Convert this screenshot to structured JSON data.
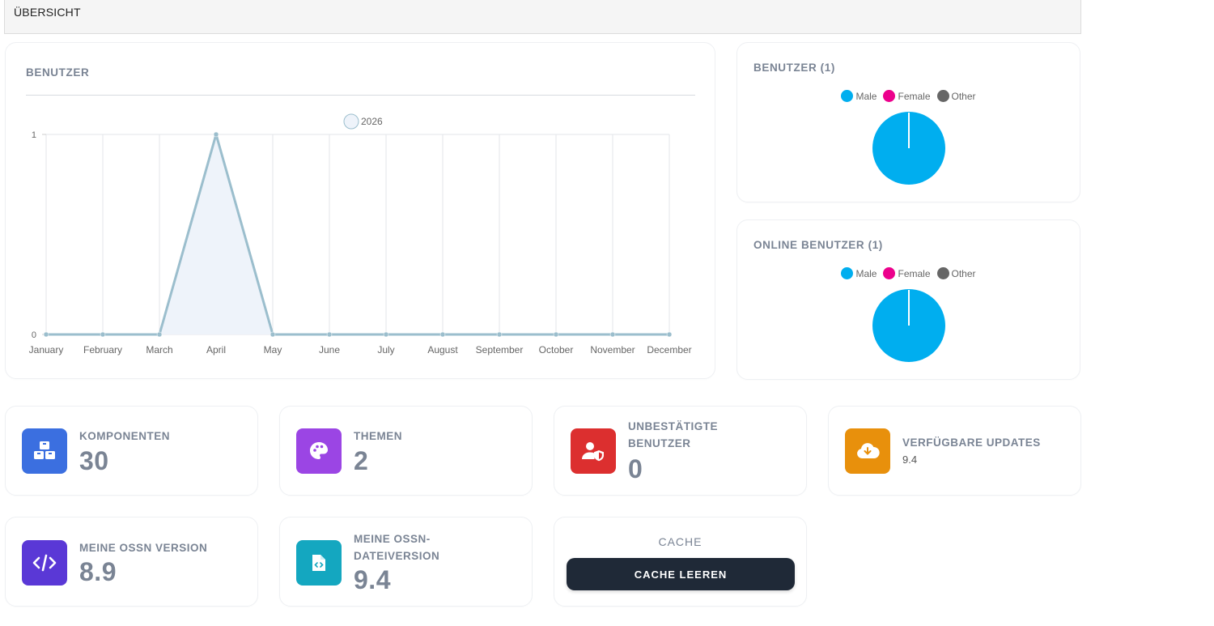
{
  "header": {
    "title": "ÜBERSICHT"
  },
  "users_chart": {
    "title": "BENUTZER",
    "chart_data": {
      "type": "line",
      "categories": [
        "January",
        "February",
        "March",
        "April",
        "May",
        "June",
        "July",
        "August",
        "September",
        "October",
        "November",
        "December"
      ],
      "series": [
        {
          "name": "2026",
          "values": [
            0,
            0,
            0,
            1,
            0,
            0,
            0,
            0,
            0,
            0,
            0,
            0
          ]
        }
      ],
      "ylim": [
        0,
        1
      ],
      "yticks": [
        "0",
        "1"
      ],
      "grid": true,
      "legend_placement": "top-center",
      "line_color": "#9bbecd",
      "fill_color": "#eef3fa"
    }
  },
  "pie_users": {
    "title": "BENUTZER (1)",
    "legend": [
      {
        "label": "Male",
        "color": "#00aeef"
      },
      {
        "label": "Female",
        "color": "#ec008c"
      },
      {
        "label": "Other",
        "color": "#666666"
      }
    ],
    "chart_data": {
      "type": "pie",
      "categories": [
        "Male",
        "Female",
        "Other"
      ],
      "values": [
        1,
        0,
        0
      ]
    }
  },
  "pie_online": {
    "title": "ONLINE BENUTZER (1)",
    "legend": [
      {
        "label": "Male",
        "color": "#00aeef"
      },
      {
        "label": "Female",
        "color": "#ec008c"
      },
      {
        "label": "Other",
        "color": "#666666"
      }
    ],
    "chart_data": {
      "type": "pie",
      "categories": [
        "Male",
        "Female",
        "Other"
      ],
      "values": [
        1,
        0,
        0
      ]
    }
  },
  "stats": {
    "components": {
      "label": "KOMPONENTEN",
      "value": "30",
      "icon": "cubes-icon",
      "color": "#3b6fe0"
    },
    "themes": {
      "label": "THEMEN",
      "value": "2",
      "icon": "palette-icon",
      "color": "#9b45e4"
    },
    "unconfirmed": {
      "label_line1": "UNBESTÄTIGTE",
      "label_line2": "BENUTZER",
      "value": "0",
      "icon": "user-shield-icon",
      "color": "#dc2f2f"
    },
    "updates": {
      "label": "VERFÜGBARE UPDATES",
      "value": "9.4",
      "icon": "cloud-download-icon",
      "color": "#e8900c"
    },
    "ossn_version": {
      "label": "MEINE OSSN VERSION",
      "value": "8.9",
      "icon": "code-icon",
      "color": "#5a38d6"
    },
    "file_version": {
      "label_line1": "MEINE OSSN-",
      "label_line2": "DATEIVERSION",
      "value": "9.4",
      "icon": "file-code-icon",
      "color": "#14a7c0"
    },
    "cache": {
      "title": "CACHE",
      "button_label": "CACHE LEEREN"
    }
  }
}
